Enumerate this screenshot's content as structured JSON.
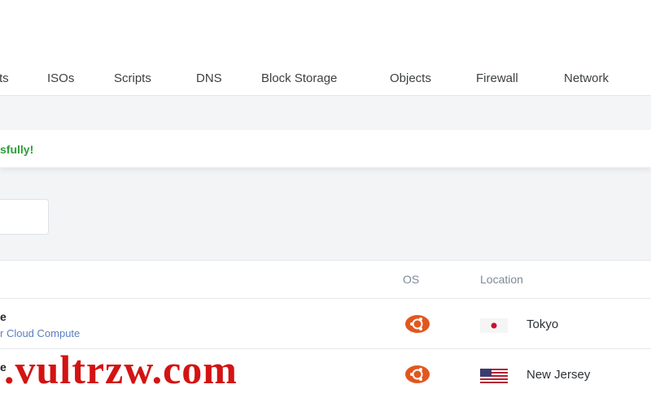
{
  "nav": {
    "items": [
      {
        "label": "ts"
      },
      {
        "label": "ISOs"
      },
      {
        "label": "Scripts"
      },
      {
        "label": "DNS"
      },
      {
        "label": "Block Storage"
      },
      {
        "label": "Objects"
      },
      {
        "label": "Firewall"
      },
      {
        "label": "Network"
      }
    ]
  },
  "alert": {
    "text": "sfully!"
  },
  "table": {
    "headers": {
      "os": "OS",
      "location": "Location"
    },
    "rows": [
      {
        "name": "e",
        "subtitle": "r Cloud Compute",
        "os_icon": "ubuntu-icon",
        "location": "Tokyo",
        "flag": "japan-flag-icon"
      },
      {
        "name": "e",
        "subtitle": "",
        "os_icon": "ubuntu-icon",
        "location": "New Jersey",
        "flag": "us-flag-icon"
      }
    ]
  },
  "watermark": {
    "text": ".vultrzw.com"
  },
  "colors": {
    "accent": "#e2571e",
    "success": "#2e9e3a",
    "link": "#5b7ec2",
    "watermark": "#d31313"
  }
}
